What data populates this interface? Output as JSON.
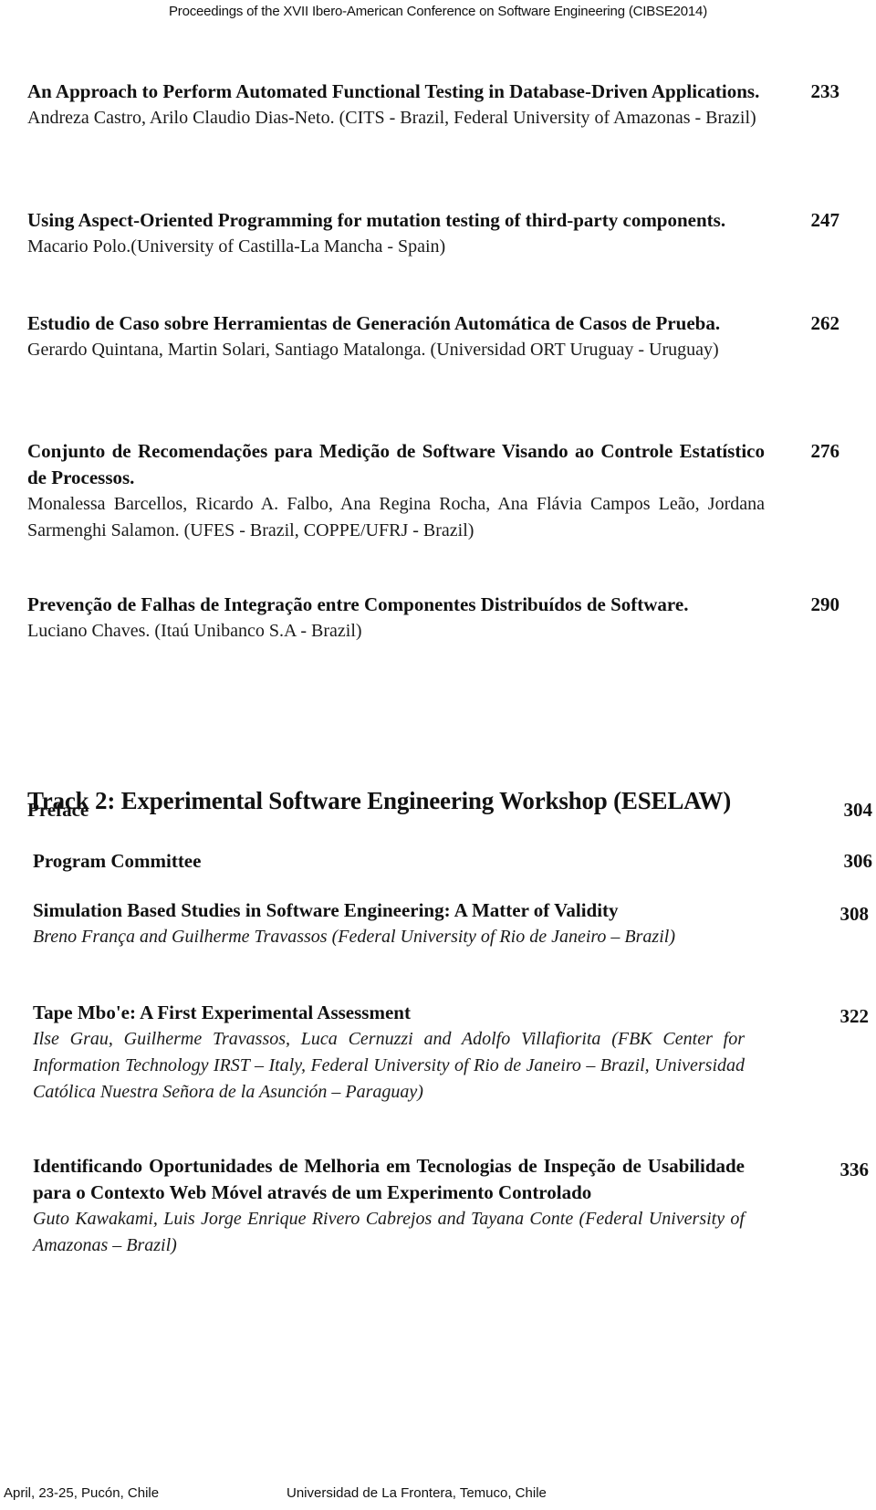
{
  "header": {
    "running_title": "Proceedings of the XVII Ibero-American Conference on Software Engineering (CIBSE2014)"
  },
  "track1_entries": [
    {
      "title": "An Approach to Perform Automated Functional Testing in Database-Driven Applications.",
      "authors": "Andreza Castro, Arilo Claudio Dias-Neto.  (CITS - Brazil, Federal University of Amazonas - Brazil)",
      "page": "233"
    },
    {
      "title": "Using Aspect-Oriented Programming for mutation testing of third-party components.",
      "authors": "Macario Polo.(University of Castilla-La Mancha - Spain)",
      "page": "247"
    },
    {
      "title": "Estudio de Caso sobre Herramientas de Generación Automática de Casos de Prueba.",
      "authors": "Gerardo Quintana, Martin Solari, Santiago Matalonga.  (Universidad ORT Uruguay - Uruguay)",
      "page": "262"
    },
    {
      "title": "Conjunto de Recomendações para Medição de Software Visando ao Controle Estatístico de Processos.",
      "authors": "Monalessa Barcellos, Ricardo A. Falbo, Ana Regina Rocha, Ana Flávia Campos Leão, Jordana Sarmenghi Salamon.  (UFES - Brazil, COPPE/UFRJ - Brazil)",
      "page": "276"
    },
    {
      "title": "Prevenção de Falhas de Integração entre Componentes Distribuídos de Software.",
      "authors": "Luciano Chaves.  (Itaú Unibanco S.A - Brazil)",
      "page": "290"
    }
  ],
  "track2": {
    "heading": "Track 2: Experimental Software Engineering Workshop (ESELAW)",
    "preface": {
      "label": "Preface",
      "page": "304"
    },
    "committee": {
      "label": "Program Committee",
      "page": "306"
    },
    "entries": [
      {
        "title": "Simulation Based Studies in Software Engineering: A Matter of Validity",
        "authors": "Breno França and Guilherme Travassos (Federal University of Rio de Janeiro – Brazil)",
        "page": "308"
      },
      {
        "title": "Tape Mbo'e: A  First Experimental Assessment",
        "authors": "Ilse Grau, Guilherme Travassos, Luca Cernuzzi and Adolfo Villafiorita (FBK Center for Information Technology IRST –  Italy, Federal University of Rio de Janeiro – Brazil, Universidad Católica Nuestra Señora de la Asunción – Paraguay)",
        "page": "322"
      },
      {
        "title": "Identificando Oportunidades de Melhoria em Tecnologias de Inspeção de Usabilidade para o Contexto Web Móvel através de um Experimento Controlado",
        "authors": "Guto Kawakami, Luis Jorge Enrique Rivero Cabrejos and Tayana Conte (Federal University of Amazonas – Brazil)",
        "page": "336"
      }
    ]
  },
  "footer": {
    "left": "April, 23-25, Pucón, Chile",
    "right": "Universidad de La Frontera, Temuco, Chile"
  }
}
